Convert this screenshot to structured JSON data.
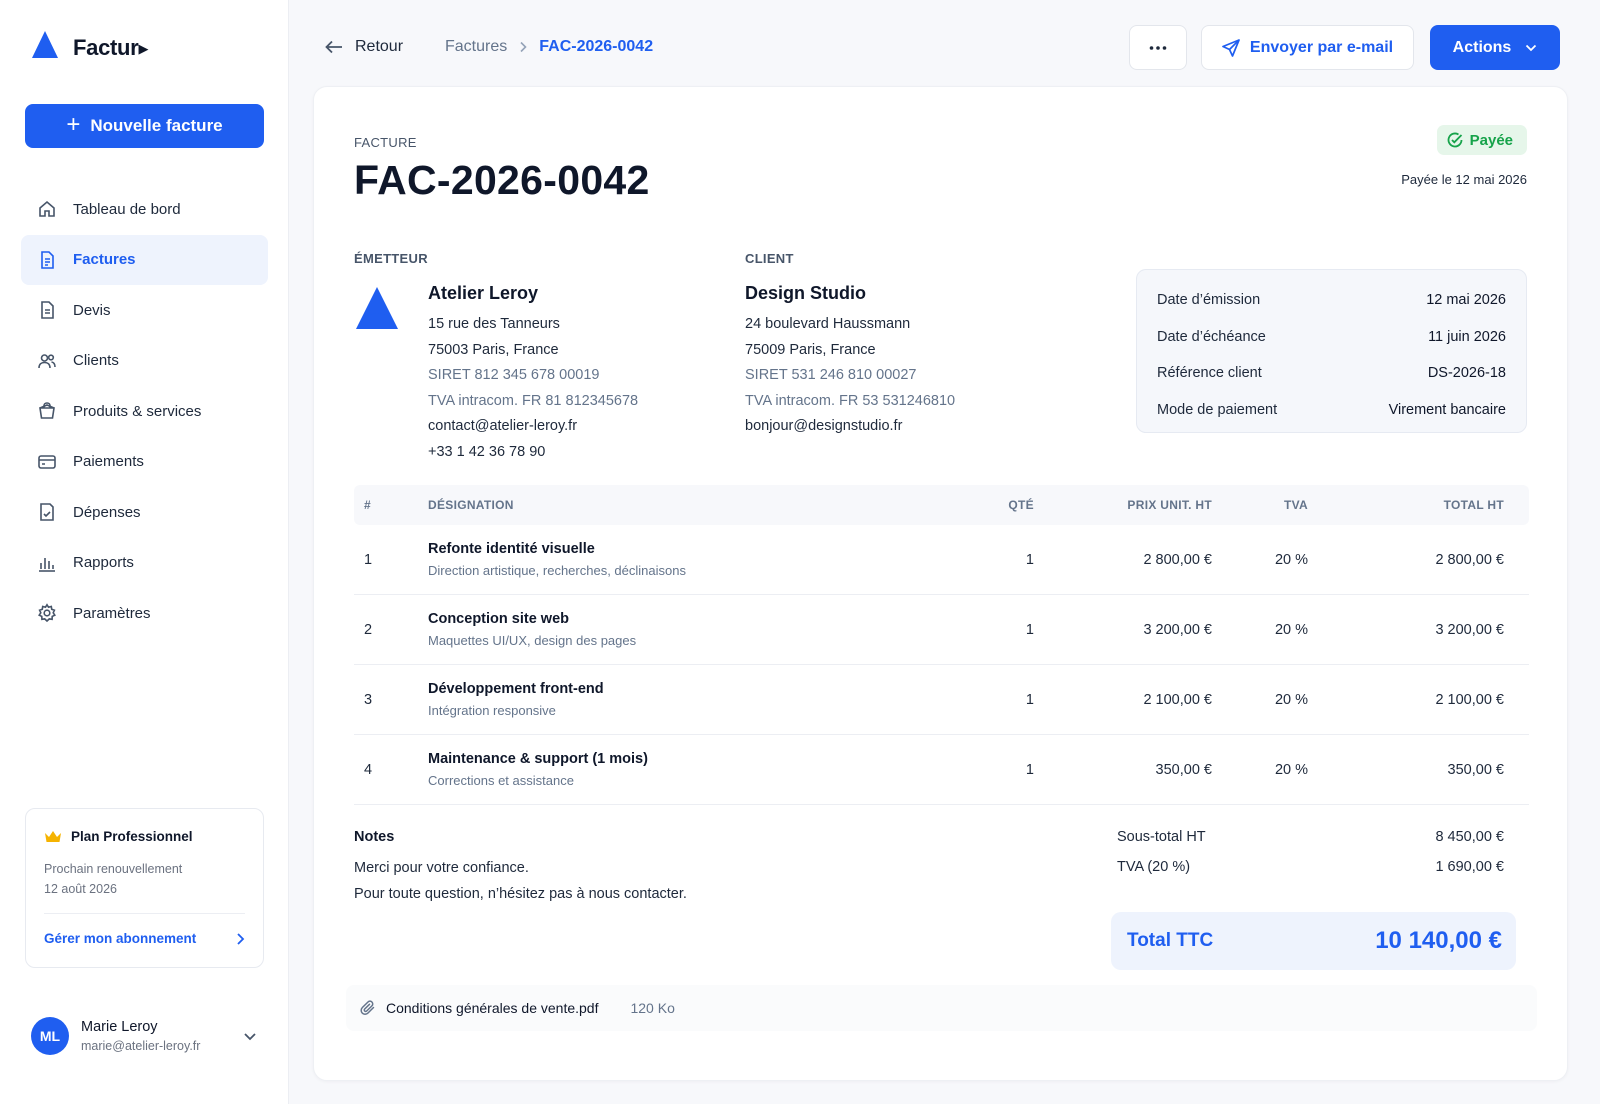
{
  "app": {
    "name": "Factur"
  },
  "sidebar": {
    "new_invoice": "Nouvelle facture",
    "items": [
      {
        "label": "Tableau de bord",
        "icon": "home-icon",
        "active": false
      },
      {
        "label": "Factures",
        "icon": "invoice-icon",
        "active": true
      },
      {
        "label": "Devis",
        "icon": "quote-icon",
        "active": false
      },
      {
        "label": "Clients",
        "icon": "users-icon",
        "active": false
      },
      {
        "label": "Produits & services",
        "icon": "basket-icon",
        "active": false
      },
      {
        "label": "Paiements",
        "icon": "card-icon",
        "active": false
      },
      {
        "label": "Dépenses",
        "icon": "receipt-icon",
        "active": false
      },
      {
        "label": "Rapports",
        "icon": "bar-chart-icon",
        "active": false
      },
      {
        "label": "Paramètres",
        "icon": "gear-icon",
        "active": false
      }
    ],
    "plan": {
      "title": "Plan Professionnel",
      "renewal_label": "Prochain renouvellement",
      "renewal_date": "12 août 2026",
      "manage_link": "Gérer mon abonnement"
    },
    "user": {
      "initials": "ML",
      "name": "Marie Leroy",
      "email": "marie@atelier-leroy.fr"
    }
  },
  "topbar": {
    "back": "Retour",
    "breadcrumb": [
      "Factures",
      "FAC-2026-0042"
    ],
    "send_email": "Envoyer par e-mail",
    "actions": "Actions"
  },
  "invoice": {
    "doc_label": "FACTURE",
    "number": "FAC-2026-0042",
    "status": "Payée",
    "paid_on": "Payée le 12 mai 2026",
    "issuer": {
      "section": "ÉMETTEUR",
      "name": "Atelier Leroy",
      "address1": "15 rue des Tanneurs",
      "address2": "75003 Paris, France",
      "siret": "SIRET 812 345 678 00019",
      "vat": "TVA intracom. FR 81 812345678",
      "email": "contact@atelier-leroy.fr",
      "phone": "+33 1 42 36 78 90"
    },
    "client": {
      "section": "CLIENT",
      "name": "Design Studio",
      "address1": "24 boulevard Haussmann",
      "address2": "75009 Paris, France",
      "siret": "SIRET 531 246 810 00027",
      "vat": "TVA intracom. FR 53 531246810",
      "email": "bonjour@designstudio.fr"
    },
    "meta": {
      "issue_label": "Date d’émission",
      "issue_value": "12 mai 2026",
      "due_label": "Date d’échéance",
      "due_value": "11 juin 2026",
      "ref_label": "Référence client",
      "ref_value": "DS-2026-18",
      "pay_label": "Mode de paiement",
      "pay_value": "Virement bancaire"
    },
    "table": {
      "headers": {
        "num": "#",
        "designation": "DÉSIGNATION",
        "qty": "QTÉ",
        "unit_price": "PRIX UNIT. HT",
        "vat": "TVA",
        "total": "TOTAL HT"
      },
      "rows": [
        {
          "num": "1",
          "title": "Refonte identité visuelle",
          "desc": "Direction artistique, recherches, déclinaisons",
          "qty": "1",
          "unit_price": "2 800,00 €",
          "vat": "20 %",
          "total": "2 800,00 €"
        },
        {
          "num": "2",
          "title": "Conception site web",
          "desc": "Maquettes UI/UX, design des pages",
          "qty": "1",
          "unit_price": "3 200,00 €",
          "vat": "20 %",
          "total": "3 200,00 €"
        },
        {
          "num": "3",
          "title": "Développement front-end",
          "desc": "Intégration responsive",
          "qty": "1",
          "unit_price": "2 100,00 €",
          "vat": "20 %",
          "total": "2 100,00 €"
        },
        {
          "num": "4",
          "title": "Maintenance & support (1 mois)",
          "desc": "Corrections et assistance",
          "qty": "1",
          "unit_price": "350,00 €",
          "vat": "20 %",
          "total": "350,00 €"
        }
      ]
    },
    "notes": {
      "title": "Notes",
      "line1": "Merci pour votre confiance.",
      "line2": "Pour toute question, n’hésitez pas à nous contacter."
    },
    "totals": {
      "subtotal_label": "Sous-total HT",
      "subtotal_value": "8 450,00 €",
      "vat_label": "TVA (20 %)",
      "vat_value": "1 690,00 €",
      "ttc_label": "Total TTC",
      "ttc_value": "10 140,00 €"
    },
    "attachment": {
      "name": "Conditions générales de vente.pdf",
      "size": "120 Ko"
    }
  },
  "colors": {
    "accent": "#1f5ef0",
    "success": "#16a34a",
    "success_bg": "#e6f6ea"
  }
}
